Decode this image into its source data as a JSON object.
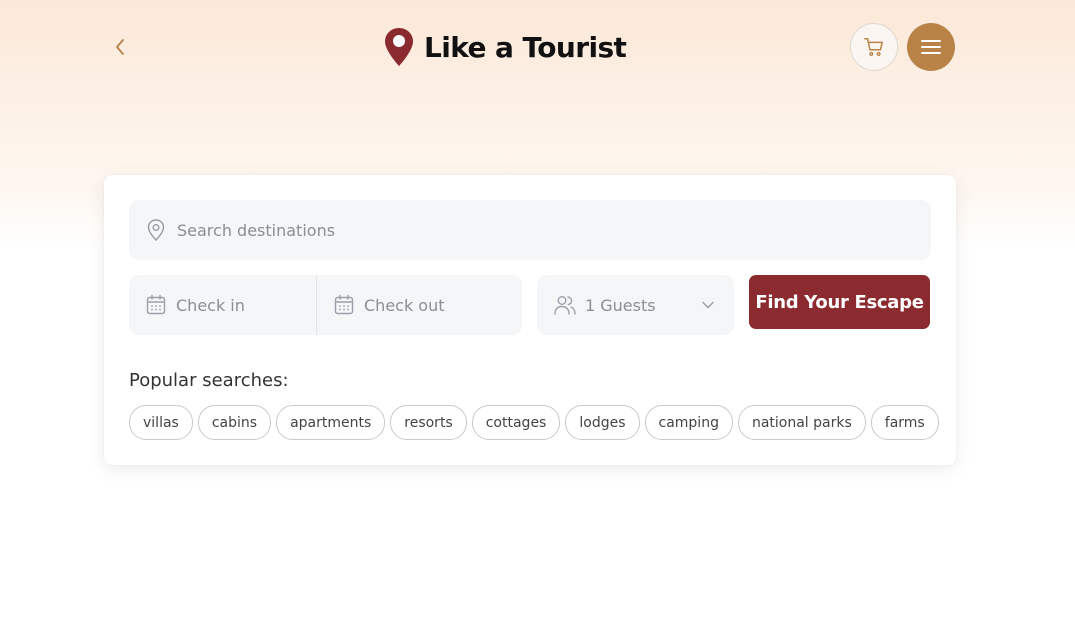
{
  "header": {
    "back_icon": "chevron-left-icon",
    "logo_icon": "map-pin-icon",
    "title": "Like a Tourist",
    "cart_icon": "shopping-cart-icon",
    "menu_icon": "hamburger-menu-icon"
  },
  "search": {
    "destination_placeholder": "Search destinations",
    "destination_icon": "map-pin-icon",
    "checkin_placeholder": "Check in",
    "checkout_placeholder": "Check out",
    "calendar_icon": "calendar-icon",
    "guests_value": "1 Guests",
    "guests_icon": "users-icon",
    "submit_label": "Find Your Escape"
  },
  "popular": {
    "label": "Popular searches:",
    "items": [
      "villas",
      "cabins",
      "apartments",
      "resorts",
      "cottages",
      "lodges",
      "camping",
      "national parks",
      "farms"
    ]
  },
  "colors": {
    "brand_red": "#8b2a2f",
    "accent_brown": "#b98247",
    "header_gradient_top": "#fbe8d8",
    "field_background": "#f5f6f8"
  }
}
